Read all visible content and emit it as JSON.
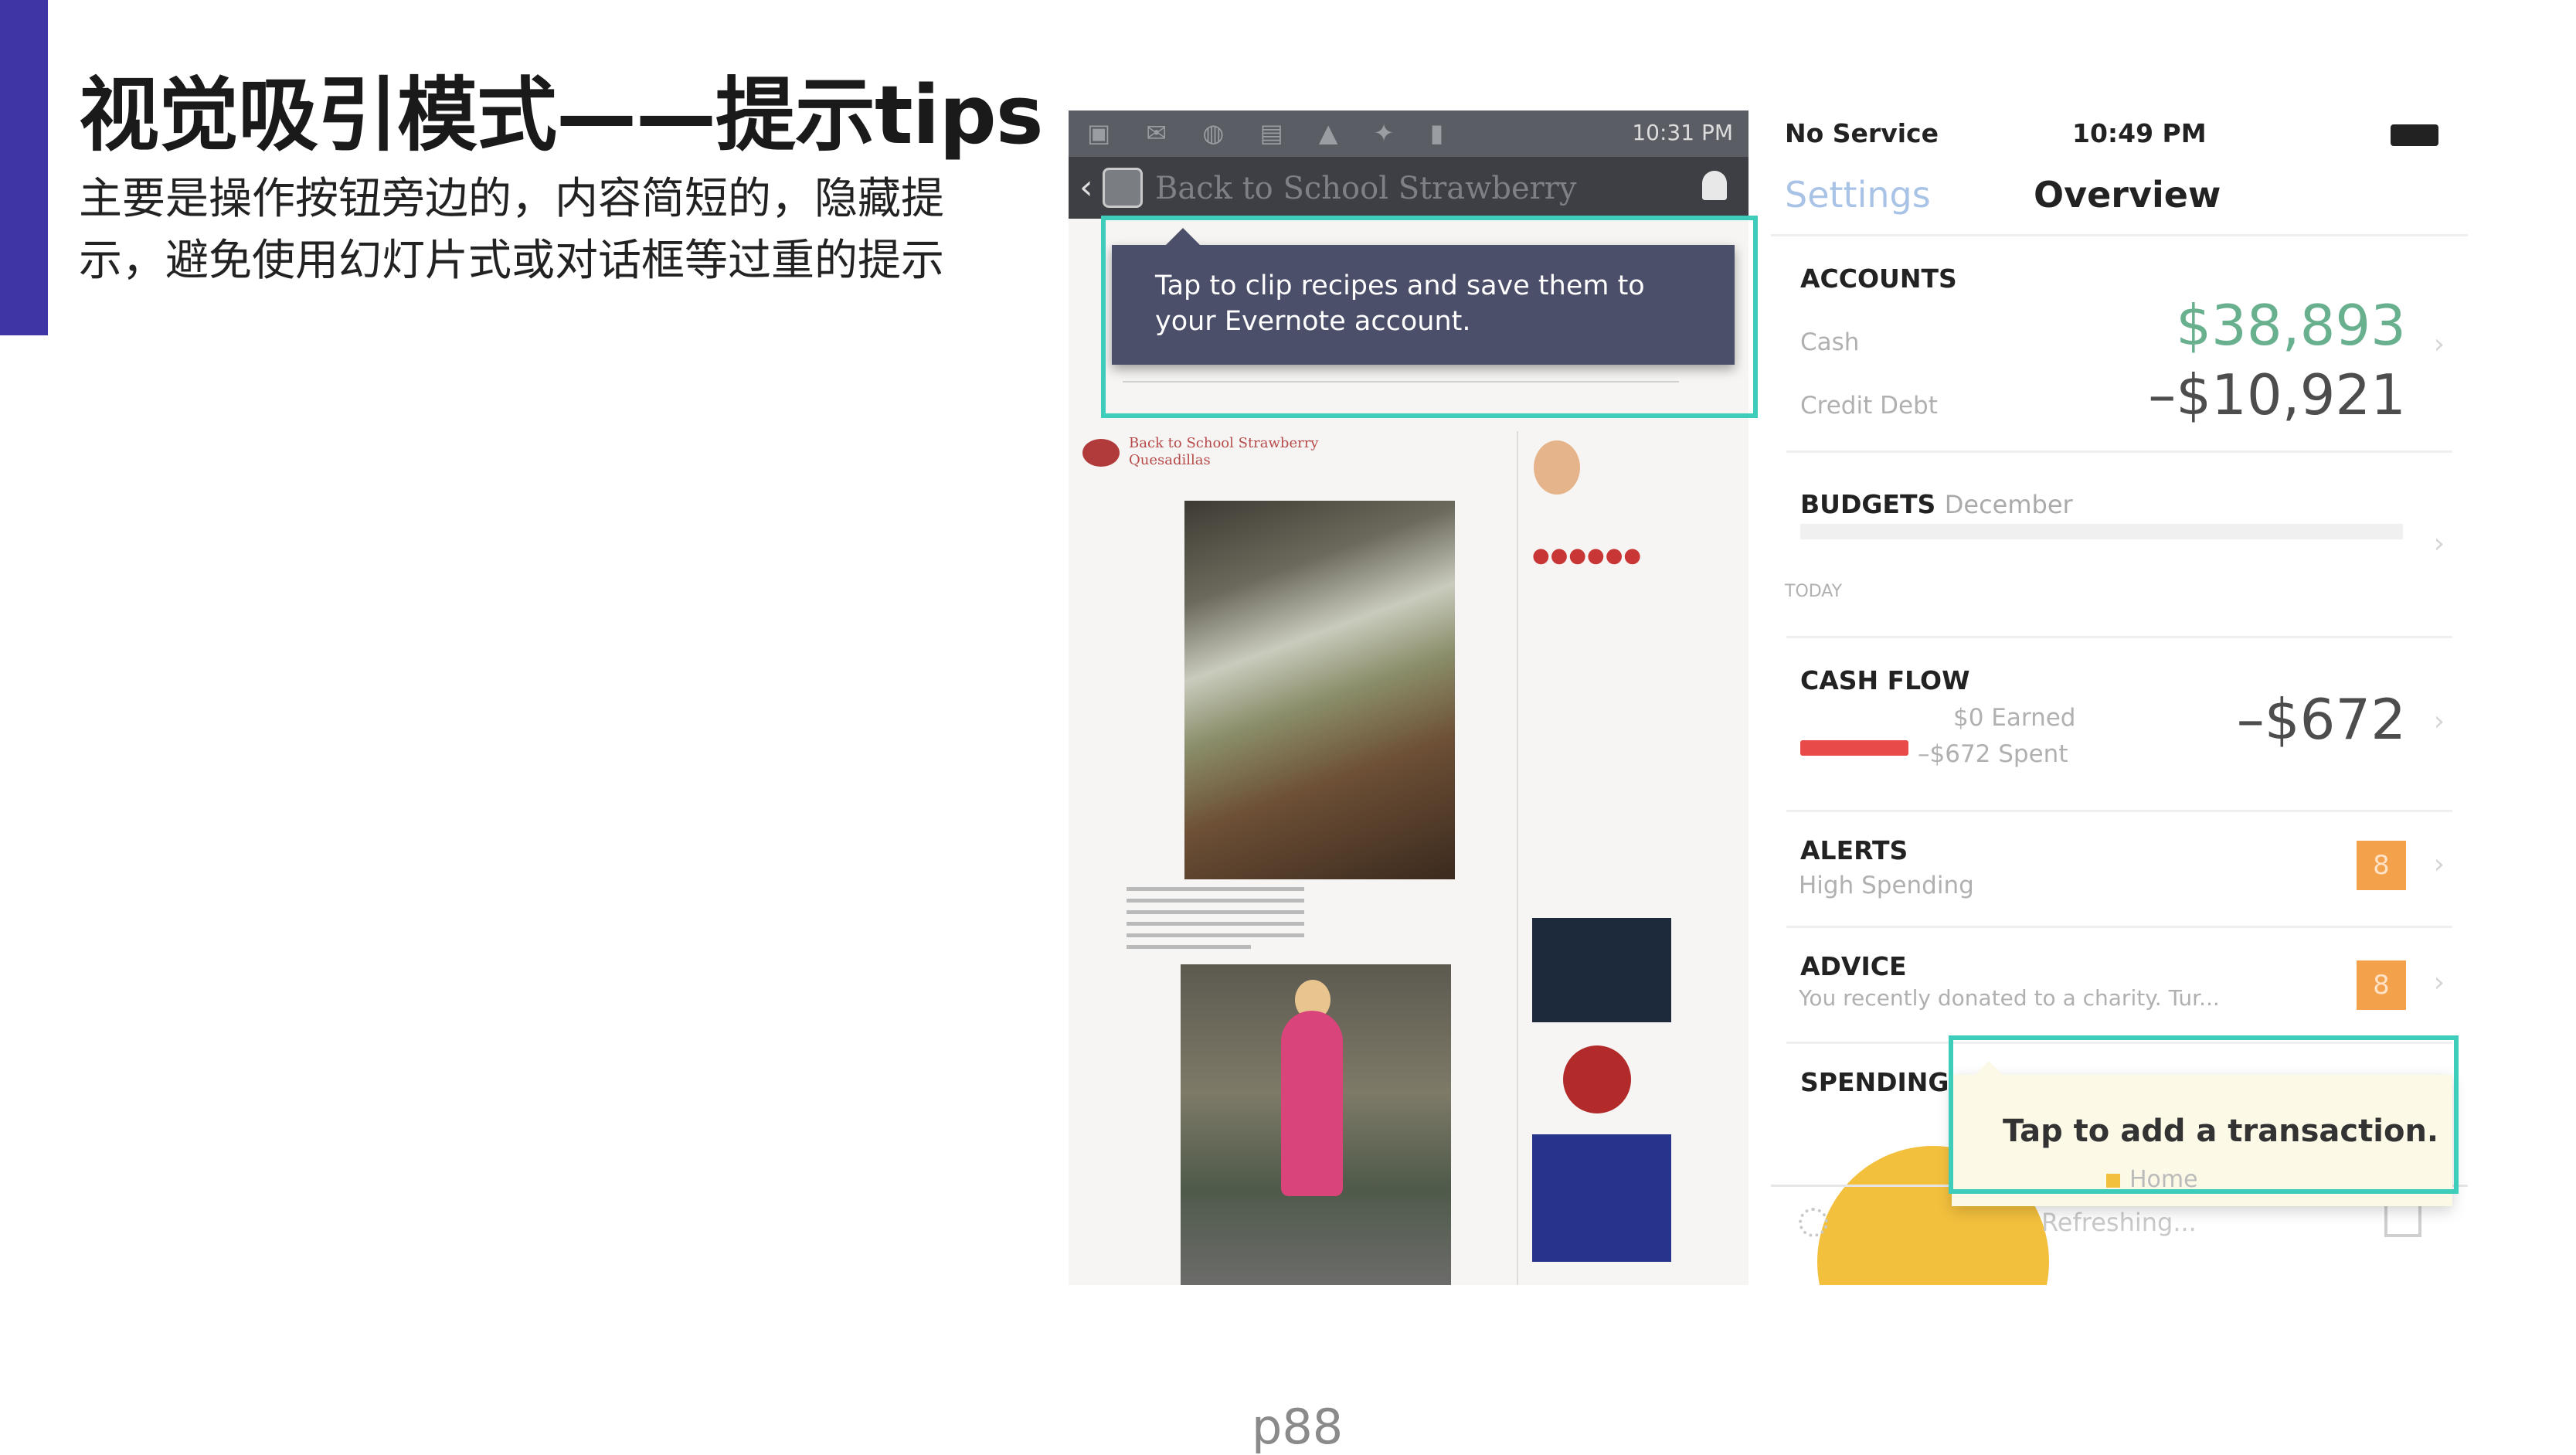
{
  "slide": {
    "title": "视觉吸引模式——提示tips",
    "subtitle": "主要是操作按钮旁边的，内容简短的，隐藏提示，避免使用幻灯片式或对话框等过重的提示",
    "page_number": "p88"
  },
  "evernote_screen": {
    "status_time": "10:31 PM",
    "page_title": "Back to School Strawberry",
    "tooltip_text": "Tap to clip recipes and save them to your Evernote account.",
    "post_title": "Back to School Strawberry Quesadillas"
  },
  "finance_screen": {
    "carrier": "No Service",
    "time": "10:49 PM",
    "nav_back": "Settings",
    "nav_title": "Overview",
    "accounts": {
      "heading": "ACCOUNTS",
      "cash_label": "Cash",
      "cash_value": "$38,893",
      "credit_label": "Credit Debt",
      "credit_value": "–$10,921"
    },
    "budgets": {
      "heading": "BUDGETS",
      "month": "December",
      "today_label": "TODAY"
    },
    "cash_flow": {
      "heading": "CASH FLOW",
      "earned": "$0 Earned",
      "spent": "–$672 Spent",
      "value": "–$672"
    },
    "alerts": {
      "heading": "ALERTS",
      "sub": "High Spending",
      "count": "8"
    },
    "advice": {
      "heading": "ADVICE",
      "sub": "You recently donated to a charity. Tur...",
      "count": "8"
    },
    "spending": {
      "heading": "SPENDING",
      "legend_home": "Home"
    },
    "tooltip_text": "Tap to add a transaction.",
    "refreshing": "Refreshing..."
  },
  "colors": {
    "accent_bar": "#3f36a6",
    "highlight_border": "#3ecdbb",
    "evernote_tooltip": "#4b4f6a",
    "finance_tooltip": "#fcf9e6",
    "badge": "#f3a14a",
    "cash_positive": "#68b08e"
  }
}
